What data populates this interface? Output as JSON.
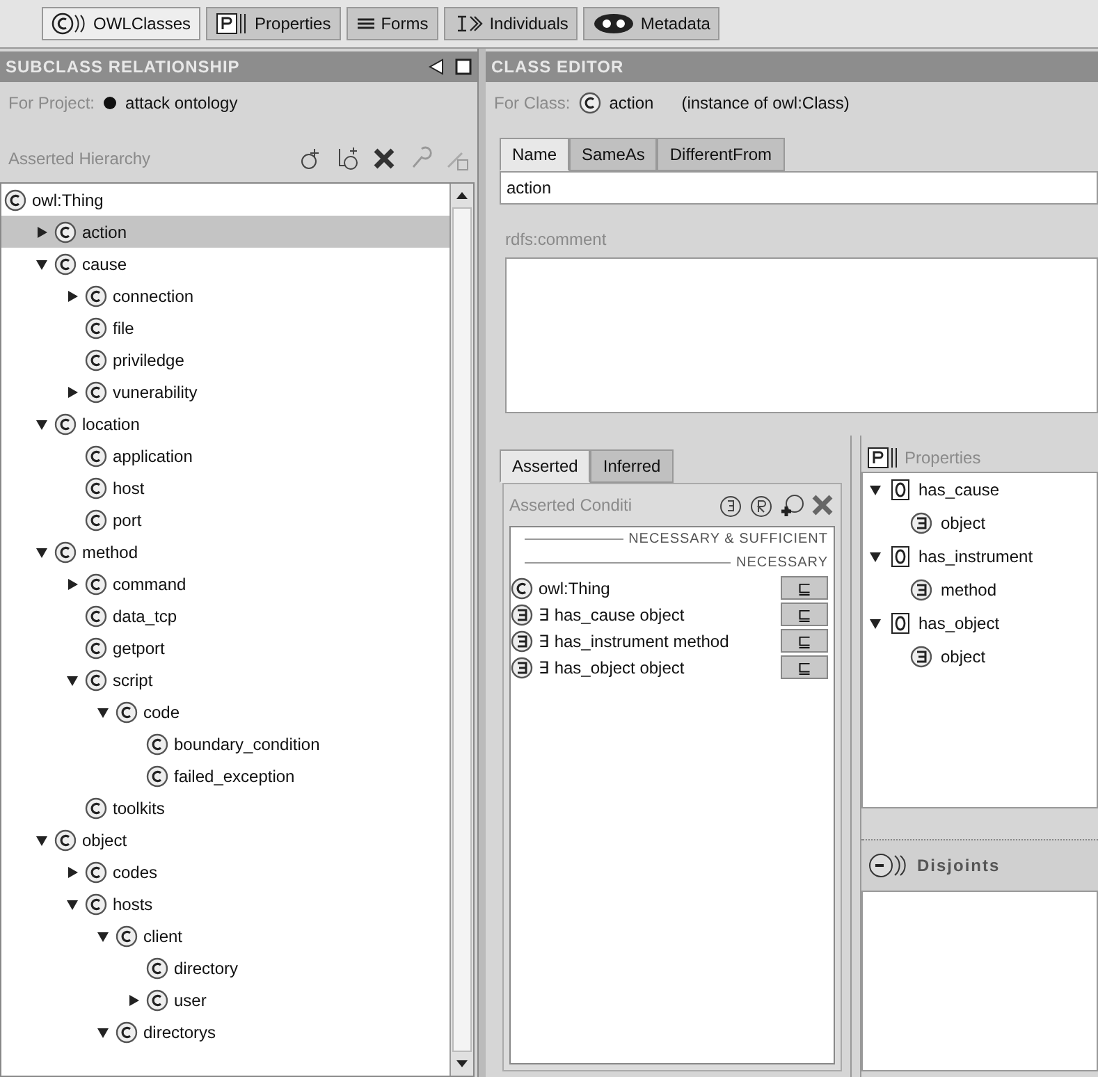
{
  "tabs": [
    {
      "label": "OWLClasses",
      "kind": "class",
      "selected": true
    },
    {
      "label": "Properties",
      "kind": "property",
      "selected": false
    },
    {
      "label": "Forms",
      "kind": "form",
      "selected": false
    },
    {
      "label": "Individuals",
      "kind": "individual",
      "selected": false
    },
    {
      "label": "Metadata",
      "kind": "metadata",
      "selected": false
    }
  ],
  "subclass_panel": {
    "title": "SUBCLASS RELATIONSHIP",
    "project_label": "For Project:",
    "project": "attack ontology",
    "hierarchy_label": "Asserted Hierarchy",
    "tree": [
      {
        "label": "owl:Thing",
        "selected": false,
        "children": [
          {
            "label": "action",
            "selected": true,
            "expanded": false
          },
          {
            "label": "cause",
            "selected": false,
            "expanded": true,
            "children": [
              {
                "label": "connection",
                "selected": false,
                "expanded": false
              },
              {
                "label": "file",
                "selected": false
              },
              {
                "label": "priviledge",
                "selected": false
              },
              {
                "label": "vunerability",
                "selected": false,
                "expanded": false
              }
            ]
          },
          {
            "label": "location",
            "selected": false,
            "expanded": true,
            "children": [
              {
                "label": "application",
                "selected": false
              },
              {
                "label": "host",
                "selected": false
              },
              {
                "label": "port",
                "selected": false
              }
            ]
          },
          {
            "label": "method",
            "selected": false,
            "expanded": true,
            "children": [
              {
                "label": "command",
                "selected": false,
                "expanded": false
              },
              {
                "label": "data_tcp",
                "selected": false
              },
              {
                "label": "getport",
                "selected": false
              },
              {
                "label": "script",
                "selected": false,
                "expanded": true,
                "children": [
                  {
                    "label": "code",
                    "selected": false,
                    "expanded": true,
                    "children": [
                      {
                        "label": "boundary_condition",
                        "selected": false
                      },
                      {
                        "label": "failed_exception",
                        "selected": false
                      }
                    ]
                  }
                ]
              },
              {
                "label": "toolkits",
                "selected": false
              }
            ]
          },
          {
            "label": "object",
            "selected": false,
            "expanded": true,
            "children": [
              {
                "label": "codes",
                "selected": false,
                "expanded": false
              },
              {
                "label": "hosts",
                "selected": false,
                "expanded": true,
                "children": [
                  {
                    "label": "client",
                    "selected": false,
                    "expanded": true,
                    "children": [
                      {
                        "label": "directory",
                        "selected": false
                      },
                      {
                        "label": "user",
                        "selected": false,
                        "expanded": false
                      }
                    ]
                  },
                  {
                    "label": "directorys",
                    "selected": false,
                    "expanded": true
                  }
                ]
              }
            ]
          }
        ]
      }
    ]
  },
  "class_editor": {
    "title": "CLASS EDITOR",
    "for_class_label": "For Class:",
    "class_name": "action",
    "class_type": "(instance of owl:Class)",
    "tabs": [
      {
        "label": "Name",
        "selected": true
      },
      {
        "label": "SameAs",
        "selected": false
      },
      {
        "label": "DifferentFrom",
        "selected": false
      }
    ],
    "name_value": "action",
    "comment_label": "rdfs:comment"
  },
  "conditions": {
    "tabs": [
      {
        "label": "Asserted",
        "selected": true
      },
      {
        "label": "Inferred",
        "selected": false
      }
    ],
    "label": "Asserted Conditi",
    "sections": [
      "NECESSARY & SUFFICIENT",
      "NECESSARY"
    ],
    "rows": [
      {
        "kind": "class",
        "text": "owl:Thing",
        "relation": "⊑"
      },
      {
        "kind": "restriction",
        "text": "∃ has_cause object",
        "relation": "⊑"
      },
      {
        "kind": "restriction",
        "text": "∃ has_instrument method",
        "relation": "⊑"
      },
      {
        "kind": "restriction",
        "text": "∃ has_object object",
        "relation": "⊑"
      }
    ]
  },
  "properties": {
    "title": "Properties",
    "tree": [
      {
        "label": "has_cause",
        "expanded": true,
        "children": [
          {
            "label": "object"
          }
        ]
      },
      {
        "label": "has_instrument",
        "expanded": true,
        "children": [
          {
            "label": "method"
          }
        ]
      },
      {
        "label": "has_object",
        "expanded": true,
        "children": [
          {
            "label": "object"
          }
        ]
      }
    ]
  },
  "disjoints": {
    "title": "Disjoints"
  }
}
